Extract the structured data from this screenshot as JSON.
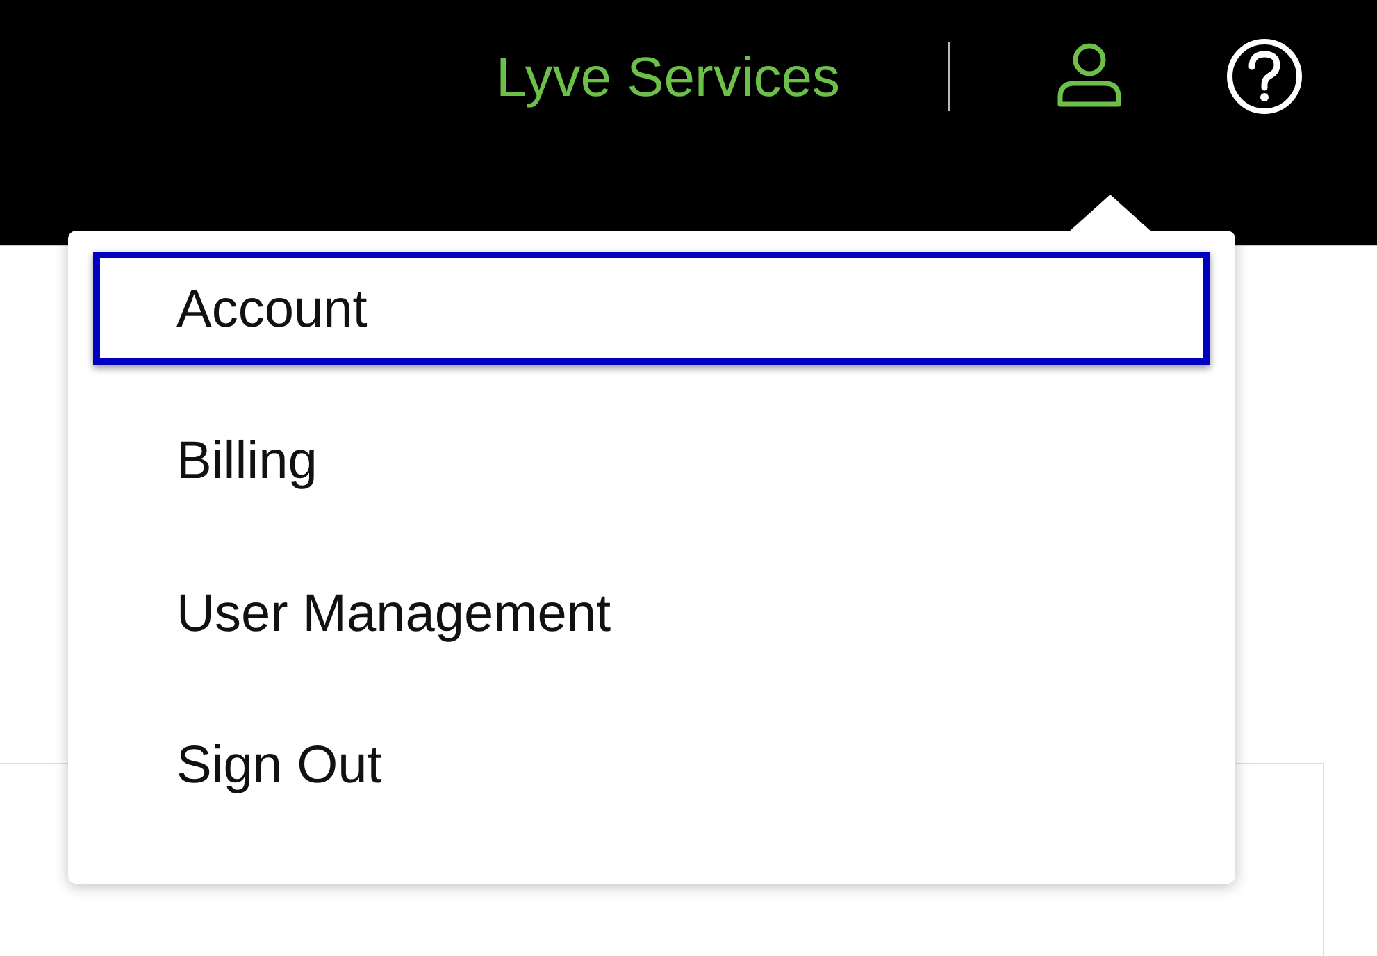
{
  "header": {
    "brand": "Lyve Services"
  },
  "menu": {
    "items": [
      {
        "label": "Account",
        "selected": true
      },
      {
        "label": "Billing",
        "selected": false
      },
      {
        "label": "User Management",
        "selected": false
      },
      {
        "label": "Sign Out",
        "selected": false
      }
    ]
  }
}
